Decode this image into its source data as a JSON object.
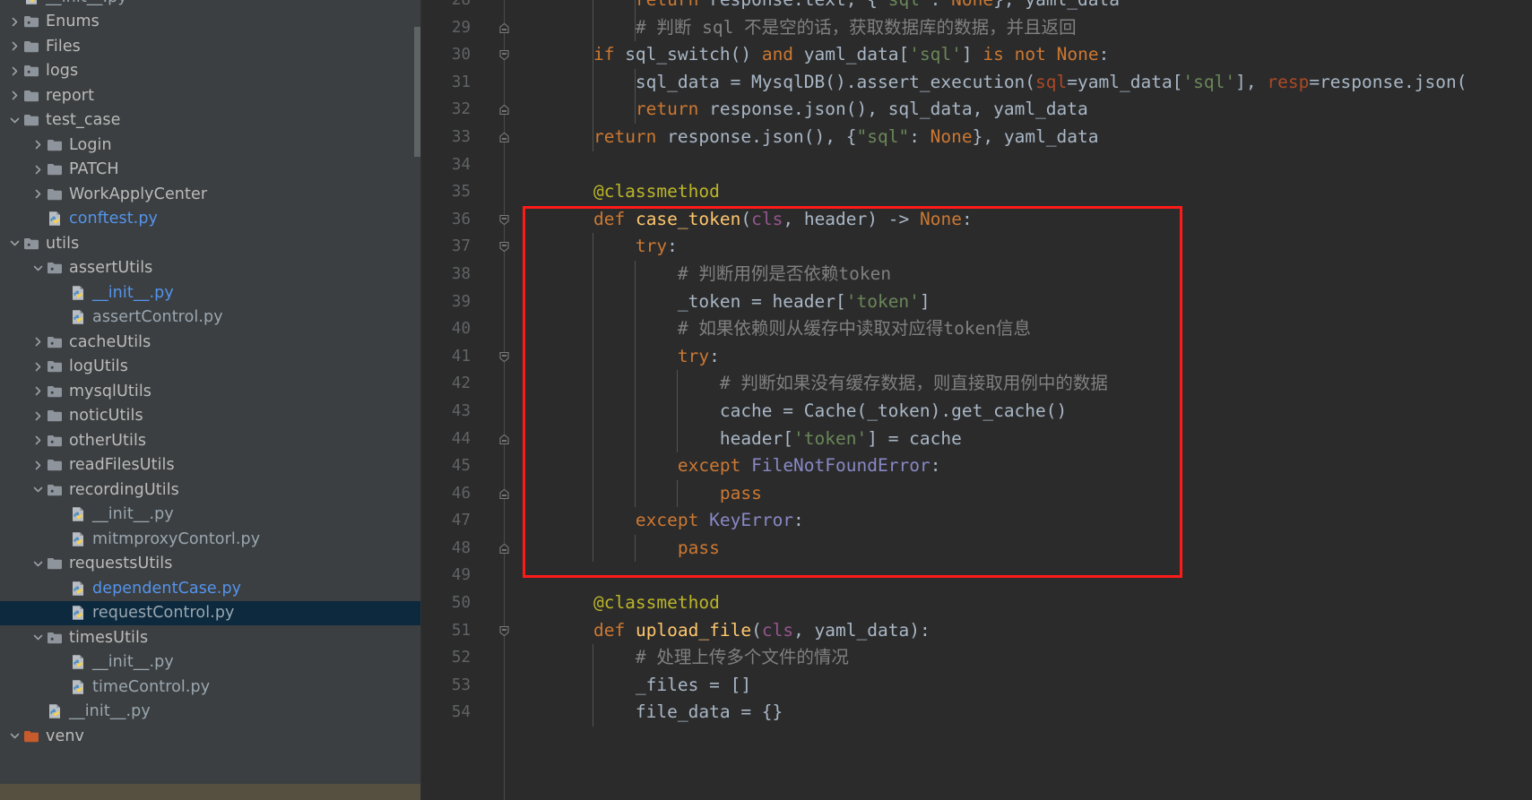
{
  "app": {
    "type": "python-ide",
    "theme": "darcula",
    "colors": {
      "sidebar_bg": "#3c3f41",
      "editor_bg": "#2b2b2b",
      "selection_bg": "#0d293e",
      "annotation_red": "#ff1a1a",
      "hscroll_thumb": "#55503f",
      "vscroll_thumb": "#5e6366",
      "line_number": "#606366",
      "keyword": "#cc7832",
      "string": "#6a8759",
      "comment": "#808080",
      "decorator": "#bbb529",
      "function": "#ffc66d",
      "param": "#94558d",
      "exception": "#8888c6",
      "kwarg": "#aa4926",
      "text": "#a9b7c6",
      "file_link": "#5394ec"
    }
  },
  "sidebar": {
    "name": "project-tree",
    "items": [
      {
        "label": "__init__.py",
        "depth": 1,
        "kind": "python",
        "state": "none",
        "partial": true,
        "selected": false
      },
      {
        "label": "Enums",
        "depth": 1,
        "kind": "folder-src",
        "state": "collapsed",
        "selected": false
      },
      {
        "label": "Files",
        "depth": 1,
        "kind": "folder",
        "state": "collapsed",
        "selected": false
      },
      {
        "label": "logs",
        "depth": 1,
        "kind": "folder-src",
        "state": "collapsed",
        "selected": false
      },
      {
        "label": "report",
        "depth": 1,
        "kind": "folder",
        "state": "collapsed",
        "selected": false
      },
      {
        "label": "test_case",
        "depth": 1,
        "kind": "folder",
        "state": "expanded",
        "selected": false
      },
      {
        "label": "Login",
        "depth": 2,
        "kind": "folder",
        "state": "collapsed",
        "selected": false
      },
      {
        "label": "PATCH",
        "depth": 2,
        "kind": "folder",
        "state": "collapsed",
        "selected": false
      },
      {
        "label": "WorkApplyCenter",
        "depth": 2,
        "kind": "folder",
        "state": "collapsed",
        "selected": false
      },
      {
        "label": "conftest.py",
        "depth": 2,
        "kind": "python",
        "state": "none",
        "link": true,
        "selected": false
      },
      {
        "label": "utils",
        "depth": 1,
        "kind": "folder-src",
        "state": "expanded",
        "selected": false
      },
      {
        "label": "assertUtils",
        "depth": 2,
        "kind": "folder-src",
        "state": "expanded",
        "selected": false
      },
      {
        "label": "__init__.py",
        "depth": 3,
        "kind": "python",
        "state": "none",
        "link": true,
        "selected": false
      },
      {
        "label": "assertControl.py",
        "depth": 3,
        "kind": "python",
        "state": "none",
        "selected": false
      },
      {
        "label": "cacheUtils",
        "depth": 2,
        "kind": "folder-src",
        "state": "collapsed",
        "selected": false
      },
      {
        "label": "logUtils",
        "depth": 2,
        "kind": "folder-src",
        "state": "collapsed",
        "selected": false
      },
      {
        "label": "mysqlUtils",
        "depth": 2,
        "kind": "folder-src",
        "state": "collapsed",
        "selected": false
      },
      {
        "label": "noticUtils",
        "depth": 2,
        "kind": "folder",
        "state": "collapsed",
        "selected": false
      },
      {
        "label": "otherUtils",
        "depth": 2,
        "kind": "folder-src",
        "state": "collapsed",
        "selected": false
      },
      {
        "label": "readFilesUtils",
        "depth": 2,
        "kind": "folder",
        "state": "collapsed",
        "selected": false
      },
      {
        "label": "recordingUtils",
        "depth": 2,
        "kind": "folder-src",
        "state": "expanded",
        "selected": false
      },
      {
        "label": "__init__.py",
        "depth": 3,
        "kind": "python",
        "state": "none",
        "selected": false
      },
      {
        "label": "mitmproxyContorl.py",
        "depth": 3,
        "kind": "python",
        "state": "none",
        "selected": false
      },
      {
        "label": "requestsUtils",
        "depth": 2,
        "kind": "folder",
        "state": "expanded",
        "selected": false
      },
      {
        "label": "dependentCase.py",
        "depth": 3,
        "kind": "python",
        "state": "none",
        "link": true,
        "selected": false
      },
      {
        "label": "requestControl.py",
        "depth": 3,
        "kind": "python",
        "state": "none",
        "selected": true
      },
      {
        "label": "timesUtils",
        "depth": 2,
        "kind": "folder-src",
        "state": "expanded",
        "selected": false
      },
      {
        "label": "__init__.py",
        "depth": 3,
        "kind": "python",
        "state": "none",
        "selected": false
      },
      {
        "label": "timeControl.py",
        "depth": 3,
        "kind": "python",
        "state": "none",
        "selected": false
      },
      {
        "label": "__init__.py",
        "depth": 2,
        "kind": "python",
        "state": "none",
        "selected": false
      },
      {
        "label": "venv",
        "depth": 1,
        "kind": "folder-orange",
        "state": "expanded",
        "selected": false
      }
    ]
  },
  "editor": {
    "name": "code-editor",
    "language": "python",
    "first_visible_line": 28,
    "lines": [
      {
        "n": 28,
        "fold": null,
        "indent_guides": [
          1,
          2
        ],
        "tokens": [
          {
            "t": "        ",
            "c": "pln"
          },
          {
            "t": "return",
            "c": "kw"
          },
          {
            "t": " response.text, {",
            "c": "pln"
          },
          {
            "t": "\"sql\"",
            "c": "str"
          },
          {
            "t": ": ",
            "c": "pln"
          },
          {
            "t": "None",
            "c": "kw"
          },
          {
            "t": "}, yaml_data",
            "c": "pln"
          }
        ]
      },
      {
        "n": 29,
        "fold": "end",
        "indent_guides": [
          1,
          2
        ],
        "tokens": [
          {
            "t": "        # 判断 sql 不是空的话，获取数据库的数据，并且返回",
            "c": "cmt"
          }
        ]
      },
      {
        "n": 30,
        "fold": "open",
        "indent_guides": [
          1
        ],
        "tokens": [
          {
            "t": "    ",
            "c": "pln"
          },
          {
            "t": "if",
            "c": "kw"
          },
          {
            "t": " sql_switch() ",
            "c": "pln"
          },
          {
            "t": "and",
            "c": "kw"
          },
          {
            "t": " yaml_data[",
            "c": "pln"
          },
          {
            "t": "'sql'",
            "c": "str"
          },
          {
            "t": "] ",
            "c": "pln"
          },
          {
            "t": "is",
            "c": "kw"
          },
          {
            "t": " ",
            "c": "pln"
          },
          {
            "t": "not",
            "c": "kw"
          },
          {
            "t": " ",
            "c": "pln"
          },
          {
            "t": "None",
            "c": "kw"
          },
          {
            "t": ":",
            "c": "pln"
          }
        ]
      },
      {
        "n": 31,
        "fold": null,
        "indent_guides": [
          1,
          2
        ],
        "tokens": [
          {
            "t": "        sql_data = MysqlDB().assert_execution(",
            "c": "pln"
          },
          {
            "t": "sql",
            "c": "kwarg"
          },
          {
            "t": "=yaml_data[",
            "c": "pln"
          },
          {
            "t": "'sql'",
            "c": "str"
          },
          {
            "t": "], ",
            "c": "pln"
          },
          {
            "t": "resp",
            "c": "kwarg"
          },
          {
            "t": "=response.json(",
            "c": "pln"
          }
        ]
      },
      {
        "n": 32,
        "fold": "end",
        "indent_guides": [
          1,
          2
        ],
        "tokens": [
          {
            "t": "        ",
            "c": "pln"
          },
          {
            "t": "return",
            "c": "kw"
          },
          {
            "t": " response.json(), sql_data, yaml_data",
            "c": "pln"
          }
        ]
      },
      {
        "n": 33,
        "fold": "end",
        "indent_guides": [
          1
        ],
        "tokens": [
          {
            "t": "    ",
            "c": "pln"
          },
          {
            "t": "return",
            "c": "kw"
          },
          {
            "t": " response.json(), {",
            "c": "pln"
          },
          {
            "t": "\"sql\"",
            "c": "str"
          },
          {
            "t": ": ",
            "c": "pln"
          },
          {
            "t": "None",
            "c": "kw"
          },
          {
            "t": "}, yaml_data",
            "c": "pln"
          }
        ]
      },
      {
        "n": 34,
        "fold": null,
        "indent_guides": [],
        "tokens": []
      },
      {
        "n": 35,
        "fold": null,
        "indent_guides": [],
        "tokens": [
          {
            "t": "    @classmethod",
            "c": "dec"
          }
        ]
      },
      {
        "n": 36,
        "fold": "open",
        "indent_guides": [],
        "tokens": [
          {
            "t": "    ",
            "c": "pln"
          },
          {
            "t": "def",
            "c": "kw"
          },
          {
            "t": " ",
            "c": "pln"
          },
          {
            "t": "case_token",
            "c": "fn"
          },
          {
            "t": "(",
            "c": "pln"
          },
          {
            "t": "cls",
            "c": "self"
          },
          {
            "t": ", header) -> ",
            "c": "pln"
          },
          {
            "t": "None",
            "c": "kw"
          },
          {
            "t": ":",
            "c": "pln"
          }
        ]
      },
      {
        "n": 37,
        "fold": "open",
        "indent_guides": [
          1
        ],
        "tokens": [
          {
            "t": "        ",
            "c": "pln"
          },
          {
            "t": "try",
            "c": "kw"
          },
          {
            "t": ":",
            "c": "pln"
          }
        ]
      },
      {
        "n": 38,
        "fold": null,
        "indent_guides": [
          1,
          2
        ],
        "tokens": [
          {
            "t": "            # 判断用例是否依赖token",
            "c": "cmt"
          }
        ]
      },
      {
        "n": 39,
        "fold": null,
        "indent_guides": [
          1,
          2
        ],
        "tokens": [
          {
            "t": "            _token = header[",
            "c": "pln"
          },
          {
            "t": "'token'",
            "c": "str"
          },
          {
            "t": "]",
            "c": "pln"
          }
        ]
      },
      {
        "n": 40,
        "fold": null,
        "indent_guides": [
          1,
          2
        ],
        "tokens": [
          {
            "t": "            # 如果依赖则从缓存中读取对应得token信息",
            "c": "cmt"
          }
        ]
      },
      {
        "n": 41,
        "fold": "open",
        "indent_guides": [
          1,
          2
        ],
        "tokens": [
          {
            "t": "            ",
            "c": "pln"
          },
          {
            "t": "try",
            "c": "kw"
          },
          {
            "t": ":",
            "c": "pln"
          }
        ]
      },
      {
        "n": 42,
        "fold": null,
        "indent_guides": [
          1,
          2,
          3
        ],
        "tokens": [
          {
            "t": "                # 判断如果没有缓存数据，则直接取用例中的数据",
            "c": "cmt"
          }
        ]
      },
      {
        "n": 43,
        "fold": null,
        "indent_guides": [
          1,
          2,
          3
        ],
        "tokens": [
          {
            "t": "                cache = Cache(_token).get_cache()",
            "c": "pln"
          }
        ]
      },
      {
        "n": 44,
        "fold": "end",
        "indent_guides": [
          1,
          2,
          3
        ],
        "tokens": [
          {
            "t": "                header[",
            "c": "pln"
          },
          {
            "t": "'token'",
            "c": "str"
          },
          {
            "t": "] = cache",
            "c": "pln"
          }
        ]
      },
      {
        "n": 45,
        "fold": null,
        "indent_guides": [
          1,
          2
        ],
        "tokens": [
          {
            "t": "            ",
            "c": "pln"
          },
          {
            "t": "except",
            "c": "kw"
          },
          {
            "t": " ",
            "c": "pln"
          },
          {
            "t": "FileNotFoundError",
            "c": "exc"
          },
          {
            "t": ":",
            "c": "pln"
          }
        ]
      },
      {
        "n": 46,
        "fold": "end",
        "indent_guides": [
          1,
          2,
          3
        ],
        "tokens": [
          {
            "t": "                ",
            "c": "pln"
          },
          {
            "t": "pass",
            "c": "kw"
          }
        ]
      },
      {
        "n": 47,
        "fold": null,
        "indent_guides": [
          1
        ],
        "tokens": [
          {
            "t": "        ",
            "c": "pln"
          },
          {
            "t": "except",
            "c": "kw"
          },
          {
            "t": " ",
            "c": "pln"
          },
          {
            "t": "KeyError",
            "c": "exc"
          },
          {
            "t": ":",
            "c": "pln"
          }
        ]
      },
      {
        "n": 48,
        "fold": "end",
        "indent_guides": [
          1,
          2
        ],
        "tokens": [
          {
            "t": "            ",
            "c": "pln"
          },
          {
            "t": "pass",
            "c": "kw"
          }
        ]
      },
      {
        "n": 49,
        "fold": null,
        "indent_guides": [],
        "tokens": []
      },
      {
        "n": 50,
        "fold": null,
        "indent_guides": [],
        "tokens": [
          {
            "t": "    @classmethod",
            "c": "dec"
          }
        ]
      },
      {
        "n": 51,
        "fold": "open",
        "indent_guides": [],
        "tokens": [
          {
            "t": "    ",
            "c": "pln"
          },
          {
            "t": "def",
            "c": "kw"
          },
          {
            "t": " ",
            "c": "pln"
          },
          {
            "t": "upload_file",
            "c": "fn"
          },
          {
            "t": "(",
            "c": "pln"
          },
          {
            "t": "cls",
            "c": "self"
          },
          {
            "t": ", yaml_data):",
            "c": "pln"
          }
        ]
      },
      {
        "n": 52,
        "fold": null,
        "indent_guides": [
          1
        ],
        "tokens": [
          {
            "t": "        # 处理上传多个文件的情况",
            "c": "cmt"
          }
        ]
      },
      {
        "n": 53,
        "fold": null,
        "indent_guides": [
          1
        ],
        "tokens": [
          {
            "t": "        _files = []",
            "c": "pln"
          }
        ]
      },
      {
        "n": 54,
        "fold": null,
        "indent_guides": [
          1
        ],
        "tokens": [
          {
            "t": "        file_data = {}",
            "c": "pln"
          }
        ]
      }
    ]
  },
  "annotation": {
    "name": "red-highlight-box",
    "shape": "rectangle",
    "color": "#ff1a1a",
    "covers_lines": "35-48",
    "description": "red rectangle highlighting case_token method"
  }
}
